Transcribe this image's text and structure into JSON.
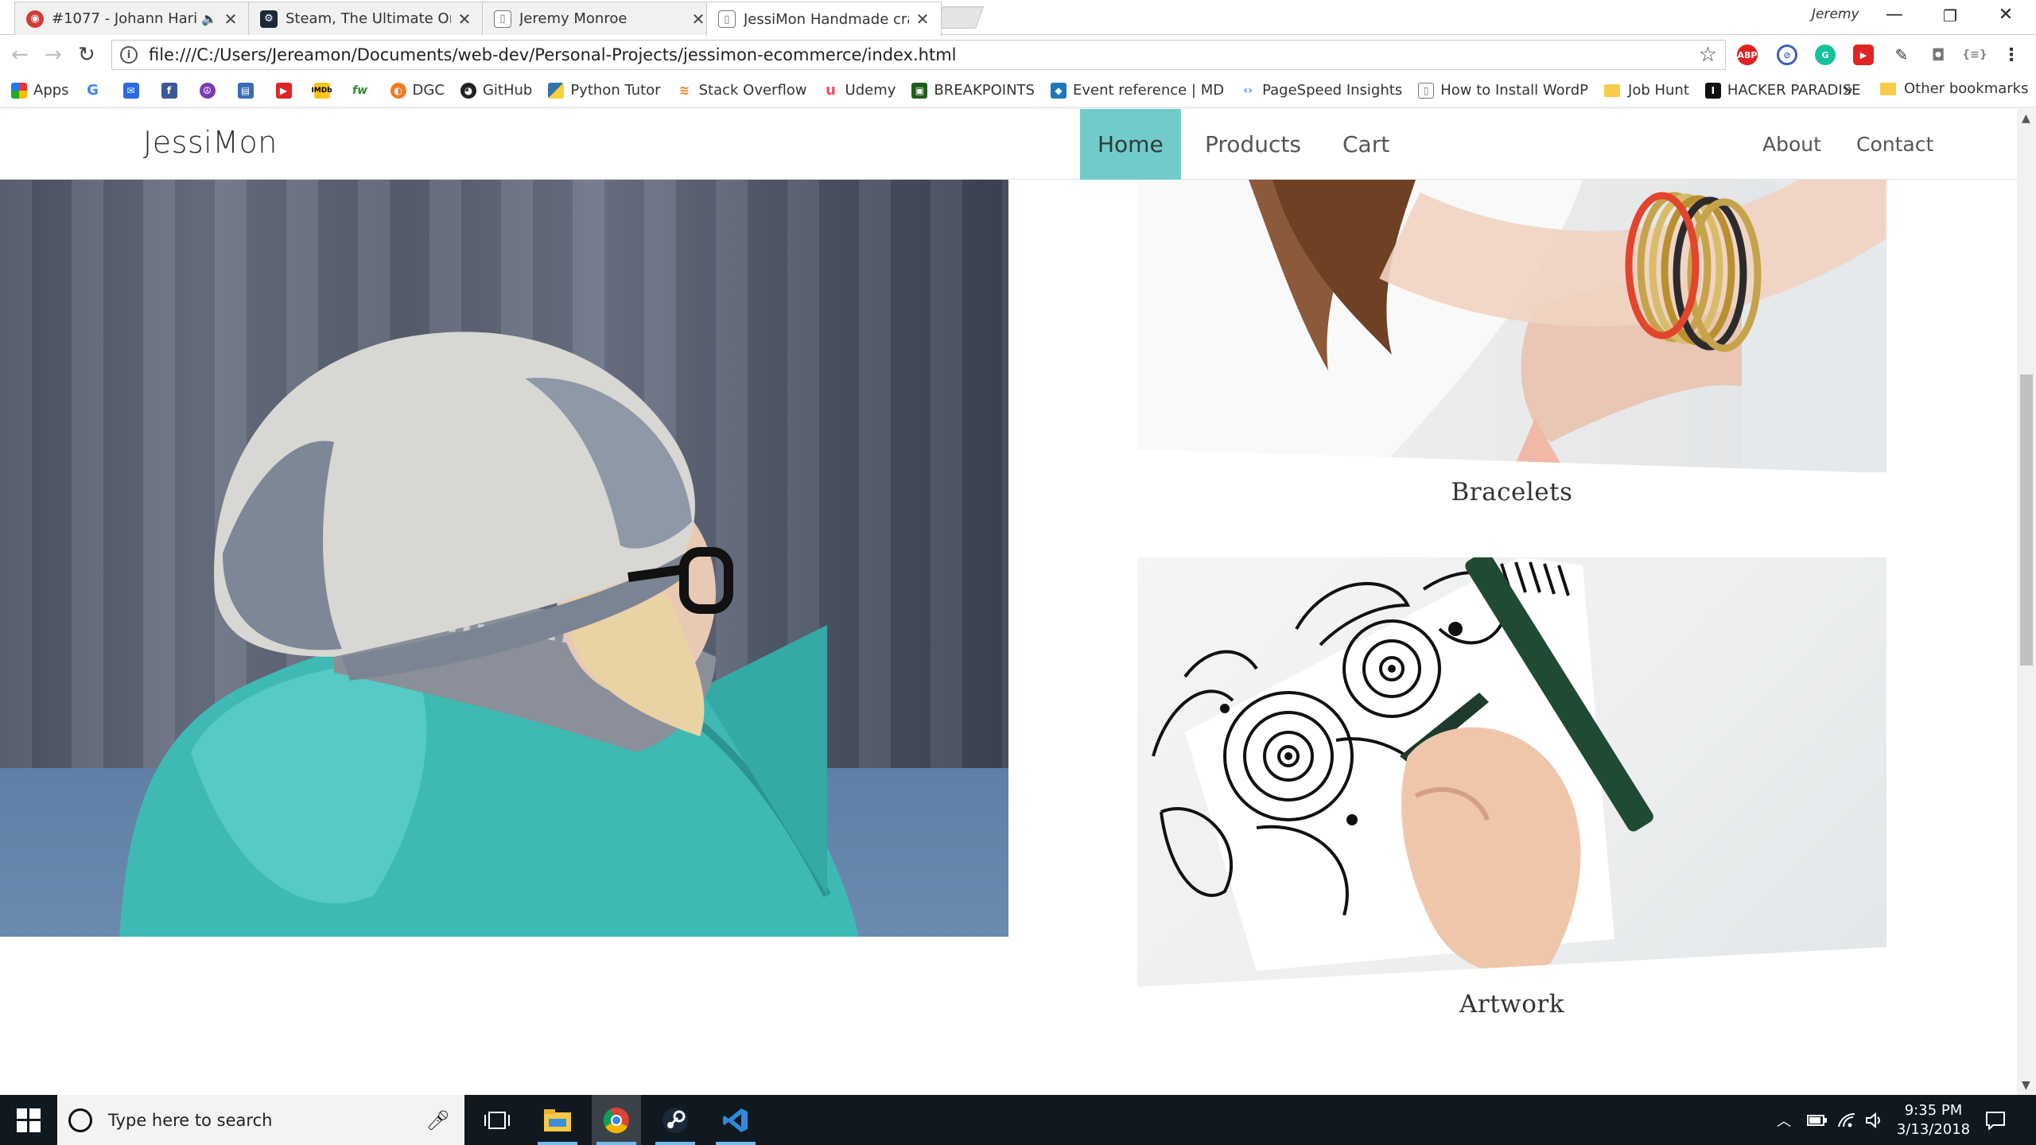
{
  "browser": {
    "tabs": [
      {
        "title": "#1077 - Johann Hari -",
        "muted": "🔈",
        "close": "✕"
      },
      {
        "title": "Steam, The Ultimate Onli",
        "close": "✕"
      },
      {
        "title": "Jeremy Monroe",
        "close": "✕"
      },
      {
        "title": "JessiMon Handmade cra",
        "close": "✕"
      }
    ],
    "profile_name": "Jeremy",
    "url": "file:///C:/Users/Jereamon/Documents/web-dev/Personal-Projects/jessimon-ecommerce/index.html",
    "bookmarks": [
      "Apps",
      "DGC",
      "GitHub",
      "Python Tutor",
      "Stack Overflow",
      "Udemy",
      "BREAKPOINTS",
      "Event reference | MD",
      "PageSpeed Insights",
      "How to Install WordP",
      "Job Hunt",
      "HACKER PARADISE"
    ],
    "bookmarks_overflow": "»",
    "other_bookmarks": "Other bookmarks"
  },
  "site": {
    "brand": "JessiMon",
    "nav": {
      "home": "Home",
      "products": "Products",
      "cart": "Cart",
      "about": "About",
      "contact": "Contact"
    },
    "products": [
      {
        "label": "Bracelets"
      },
      {
        "label": "Artwork"
      }
    ]
  },
  "taskbar": {
    "search_placeholder": "Type here to search",
    "time": "9:35 PM",
    "date": "3/13/2018"
  },
  "colors": {
    "nav_active": "#72cbcb",
    "taskbar": "#101820",
    "jacket": "#3fb9b4"
  }
}
